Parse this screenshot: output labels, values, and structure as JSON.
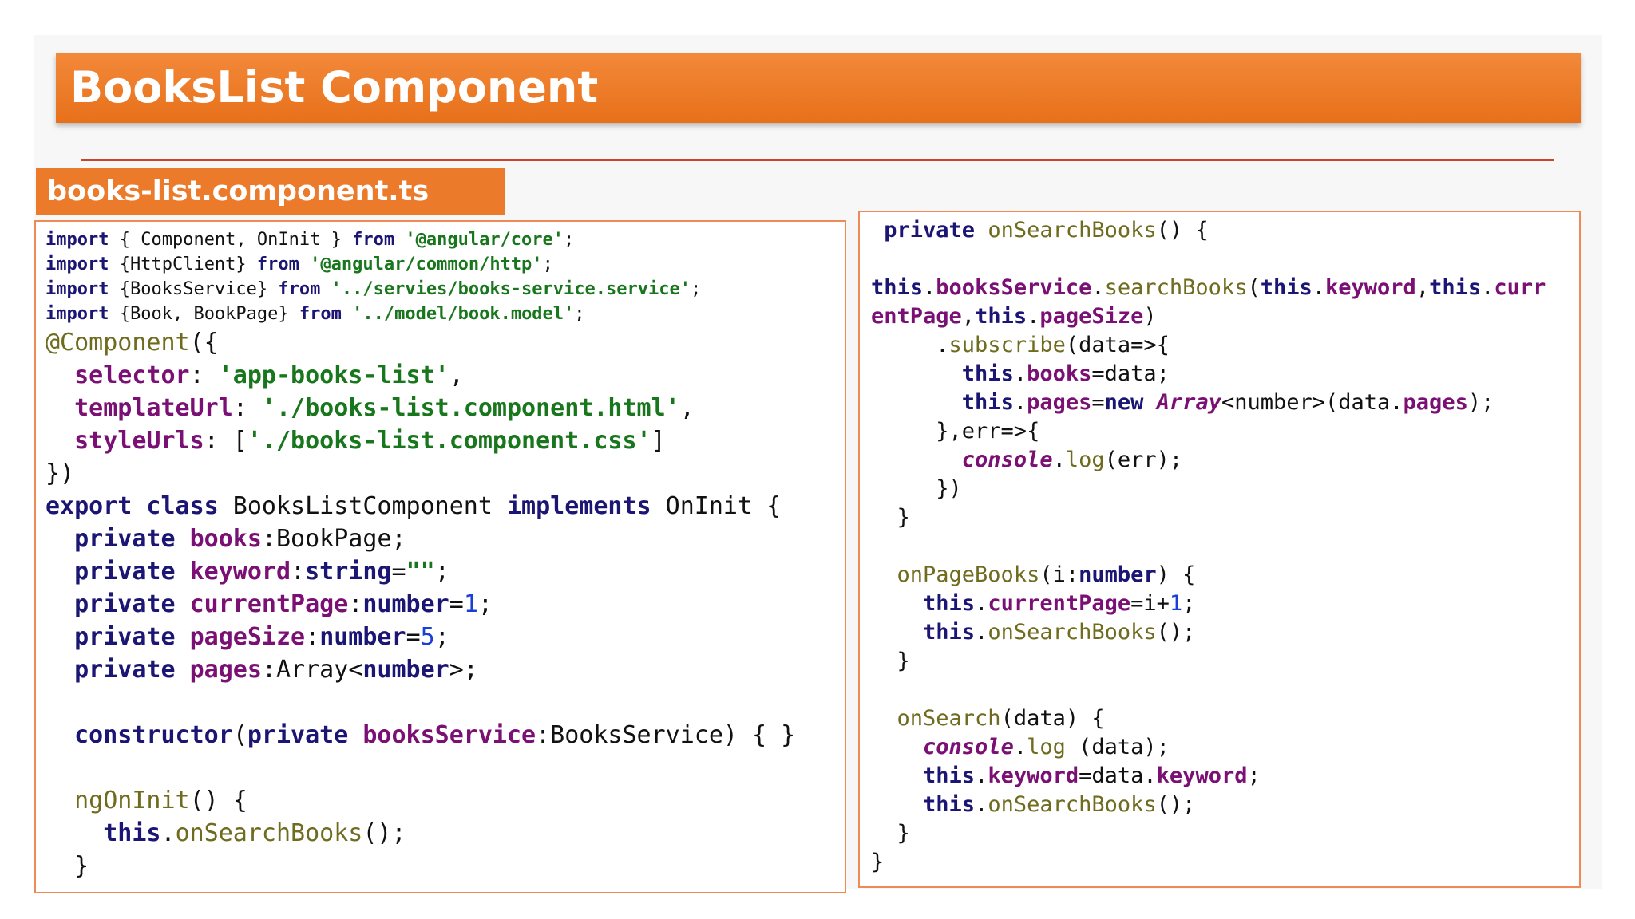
{
  "slide": {
    "title": "BooksList Component",
    "file_tab": "books-list.component.ts"
  },
  "colors": {
    "title_bar": "#e8701a",
    "rule": "#c8452a",
    "box_border": "#ed8a55",
    "keyword": "#1b1573",
    "string": "#18761c",
    "property": "#7a0f74",
    "function": "#6f6b1f",
    "number": "#1b3fd6"
  },
  "left_code": [
    [
      {
        "t": "import",
        "c": "kw"
      },
      {
        "t": " { Component, OnInit } "
      },
      {
        "t": "from",
        "c": "kw"
      },
      {
        "t": " "
      },
      {
        "t": "'@angular/core'",
        "c": "str"
      },
      {
        "t": ";"
      }
    ],
    [
      {
        "t": "import",
        "c": "kw"
      },
      {
        "t": " {HttpClient} "
      },
      {
        "t": "from",
        "c": "kw"
      },
      {
        "t": " "
      },
      {
        "t": "'@angular/common/http'",
        "c": "str"
      },
      {
        "t": ";"
      }
    ],
    [
      {
        "t": "import",
        "c": "kw"
      },
      {
        "t": " {BooksService} "
      },
      {
        "t": "from",
        "c": "kw"
      },
      {
        "t": " "
      },
      {
        "t": "'../servies/books-service.service'",
        "c": "str"
      },
      {
        "t": ";"
      }
    ],
    [
      {
        "t": "import",
        "c": "kw"
      },
      {
        "t": " {Book, BookPage} "
      },
      {
        "t": "from",
        "c": "kw"
      },
      {
        "t": " "
      },
      {
        "t": "'../model/book.model'",
        "c": "str"
      },
      {
        "t": ";"
      }
    ],
    [
      {
        "t": "@Component",
        "c": "fn"
      },
      {
        "t": "({"
      }
    ],
    [
      {
        "t": "  "
      },
      {
        "t": "selector",
        "c": "prop"
      },
      {
        "t": ": "
      },
      {
        "t": "'app-books-list'",
        "c": "str"
      },
      {
        "t": ","
      }
    ],
    [
      {
        "t": "  "
      },
      {
        "t": "templateUrl",
        "c": "prop"
      },
      {
        "t": ": "
      },
      {
        "t": "'./books-list.component.html'",
        "c": "str"
      },
      {
        "t": ","
      }
    ],
    [
      {
        "t": "  "
      },
      {
        "t": "styleUrls",
        "c": "prop"
      },
      {
        "t": ": ["
      },
      {
        "t": "'./books-list.component.css'",
        "c": "str"
      },
      {
        "t": "]"
      }
    ],
    [
      {
        "t": "})"
      }
    ],
    [
      {
        "t": "export class",
        "c": "kw"
      },
      {
        "t": " BooksListComponent "
      },
      {
        "t": "implements",
        "c": "kw"
      },
      {
        "t": " OnInit {"
      }
    ],
    [
      {
        "t": "  "
      },
      {
        "t": "private",
        "c": "kw"
      },
      {
        "t": " "
      },
      {
        "t": "books",
        "c": "prop"
      },
      {
        "t": ":BookPage;"
      }
    ],
    [
      {
        "t": "  "
      },
      {
        "t": "private",
        "c": "kw"
      },
      {
        "t": " "
      },
      {
        "t": "keyword",
        "c": "prop"
      },
      {
        "t": ":"
      },
      {
        "t": "string",
        "c": "kw"
      },
      {
        "t": "="
      },
      {
        "t": "\"\"",
        "c": "str"
      },
      {
        "t": ";"
      }
    ],
    [
      {
        "t": "  "
      },
      {
        "t": "private",
        "c": "kw"
      },
      {
        "t": " "
      },
      {
        "t": "currentPage",
        "c": "prop"
      },
      {
        "t": ":"
      },
      {
        "t": "number",
        "c": "kw"
      },
      {
        "t": "="
      },
      {
        "t": "1",
        "c": "num"
      },
      {
        "t": ";"
      }
    ],
    [
      {
        "t": "  "
      },
      {
        "t": "private",
        "c": "kw"
      },
      {
        "t": " "
      },
      {
        "t": "pageSize",
        "c": "prop"
      },
      {
        "t": ":"
      },
      {
        "t": "number",
        "c": "kw"
      },
      {
        "t": "="
      },
      {
        "t": "5",
        "c": "num"
      },
      {
        "t": ";"
      }
    ],
    [
      {
        "t": "  "
      },
      {
        "t": "private",
        "c": "kw"
      },
      {
        "t": " "
      },
      {
        "t": "pages",
        "c": "prop"
      },
      {
        "t": ":Array<"
      },
      {
        "t": "number",
        "c": "kw"
      },
      {
        "t": ">;"
      }
    ],
    [
      {
        "t": "  "
      },
      {
        "t": "constructor",
        "c": "kw"
      },
      {
        "t": "("
      },
      {
        "t": "private",
        "c": "kw"
      },
      {
        "t": " "
      },
      {
        "t": "booksService",
        "c": "prop"
      },
      {
        "t": ":BooksService) { }"
      }
    ],
    [
      {
        "t": "  "
      },
      {
        "t": "ngOnInit",
        "c": "fn"
      },
      {
        "t": "() {"
      }
    ],
    [
      {
        "t": "    "
      },
      {
        "t": "this",
        "c": "kw"
      },
      {
        "t": "."
      },
      {
        "t": "onSearchBooks",
        "c": "fn"
      },
      {
        "t": "();"
      }
    ],
    [
      {
        "t": "  }"
      }
    ]
  ],
  "right_code": [
    [
      {
        "t": " "
      },
      {
        "t": "private",
        "c": "kw"
      },
      {
        "t": " "
      },
      {
        "t": "onSearchBooks",
        "c": "fn"
      },
      {
        "t": "() {"
      }
    ],
    [
      {
        "t": "this",
        "c": "kw"
      },
      {
        "t": "."
      },
      {
        "t": "booksService",
        "c": "prop"
      },
      {
        "t": "."
      },
      {
        "t": "searchBooks",
        "c": "fn"
      },
      {
        "t": "("
      },
      {
        "t": "this",
        "c": "kw"
      },
      {
        "t": "."
      },
      {
        "t": "keyword",
        "c": "prop"
      },
      {
        "t": ","
      },
      {
        "t": "this",
        "c": "kw"
      },
      {
        "t": "."
      },
      {
        "t": "curr",
        "c": "prop"
      }
    ],
    [
      {
        "t": "entPage",
        "c": "prop"
      },
      {
        "t": ","
      },
      {
        "t": "this",
        "c": "kw"
      },
      {
        "t": "."
      },
      {
        "t": "pageSize",
        "c": "prop"
      },
      {
        "t": ")"
      }
    ],
    [
      {
        "t": "     ."
      },
      {
        "t": "subscribe",
        "c": "fn"
      },
      {
        "t": "(data=>{"
      }
    ],
    [
      {
        "t": "       "
      },
      {
        "t": "this",
        "c": "kw"
      },
      {
        "t": "."
      },
      {
        "t": "books",
        "c": "prop"
      },
      {
        "t": "=data;"
      }
    ],
    [
      {
        "t": "       "
      },
      {
        "t": "this",
        "c": "kw"
      },
      {
        "t": "."
      },
      {
        "t": "pages",
        "c": "prop"
      },
      {
        "t": "="
      },
      {
        "t": "new",
        "c": "kw"
      },
      {
        "t": " "
      },
      {
        "t": "Array",
        "c": "it"
      },
      {
        "t": "<number>(data."
      },
      {
        "t": "pages",
        "c": "prop"
      },
      {
        "t": ");"
      }
    ],
    [
      {
        "t": "     },err=>{"
      }
    ],
    [
      {
        "t": "       "
      },
      {
        "t": "console",
        "c": "it"
      },
      {
        "t": "."
      },
      {
        "t": "log",
        "c": "fn"
      },
      {
        "t": "(err);"
      }
    ],
    [
      {
        "t": "     })"
      }
    ],
    [
      {
        "t": "  }"
      }
    ],
    [
      {
        "t": "  "
      },
      {
        "t": "onPageBooks",
        "c": "fn"
      },
      {
        "t": "(i:"
      },
      {
        "t": "number",
        "c": "kw"
      },
      {
        "t": ") {"
      }
    ],
    [
      {
        "t": "    "
      },
      {
        "t": "this",
        "c": "kw"
      },
      {
        "t": "."
      },
      {
        "t": "currentPage",
        "c": "prop"
      },
      {
        "t": "=i+"
      },
      {
        "t": "1",
        "c": "num"
      },
      {
        "t": ";"
      }
    ],
    [
      {
        "t": "    "
      },
      {
        "t": "this",
        "c": "kw"
      },
      {
        "t": "."
      },
      {
        "t": "onSearchBooks",
        "c": "fn"
      },
      {
        "t": "();"
      }
    ],
    [
      {
        "t": "  }"
      }
    ],
    [
      {
        "t": "  "
      },
      {
        "t": "onSearch",
        "c": "fn"
      },
      {
        "t": "(data) {"
      }
    ],
    [
      {
        "t": "    "
      },
      {
        "t": "console",
        "c": "it"
      },
      {
        "t": "."
      },
      {
        "t": "log",
        "c": "fn"
      },
      {
        "t": " (data);"
      }
    ],
    [
      {
        "t": "    "
      },
      {
        "t": "this",
        "c": "kw"
      },
      {
        "t": "."
      },
      {
        "t": "keyword",
        "c": "prop"
      },
      {
        "t": "=data."
      },
      {
        "t": "keyword",
        "c": "prop"
      },
      {
        "t": ";"
      }
    ],
    [
      {
        "t": "    "
      },
      {
        "t": "this",
        "c": "kw"
      },
      {
        "t": "."
      },
      {
        "t": "onSearchBooks",
        "c": "fn"
      },
      {
        "t": "();"
      }
    ],
    [
      {
        "t": "  }"
      }
    ],
    [
      {
        "t": "}"
      }
    ]
  ]
}
